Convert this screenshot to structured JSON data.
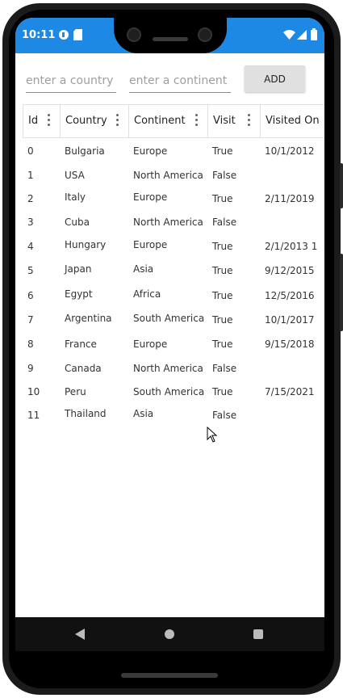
{
  "status_bar": {
    "time": "10:11",
    "bg_color": "#1e88e5"
  },
  "form": {
    "country_placeholder": "enter a country",
    "continent_placeholder": "enter a continent",
    "add_label": "ADD"
  },
  "table": {
    "columns": [
      "Id",
      "Country",
      "Continent",
      "Visit",
      "Visited On"
    ],
    "rows": [
      [
        "0",
        "Bulgaria",
        "Europe",
        "True",
        "10/1/2012"
      ],
      [
        "1",
        "USA",
        "North America",
        "False",
        ""
      ],
      [
        "2",
        "Italy",
        "Europe",
        "True",
        "2/11/2019"
      ],
      [
        "3",
        "Cuba",
        "North America",
        "False",
        ""
      ],
      [
        "4",
        "Hungary",
        "Europe",
        "True",
        "2/1/2013 1"
      ],
      [
        "5",
        "Japan",
        "Asia",
        "True",
        "9/12/2015"
      ],
      [
        "6",
        "Egypt",
        "Africa",
        "True",
        "12/5/2016"
      ],
      [
        "7",
        "Argentina",
        "South America",
        "True",
        "10/1/2017"
      ],
      [
        "8",
        "France",
        "Europe",
        "True",
        "9/15/2018"
      ],
      [
        "9",
        "Canada",
        "North America",
        "False",
        ""
      ],
      [
        "10",
        "Peru",
        "South America",
        "True",
        "7/15/2021"
      ],
      [
        "11",
        "Thailand",
        "Asia",
        "False",
        ""
      ]
    ]
  }
}
